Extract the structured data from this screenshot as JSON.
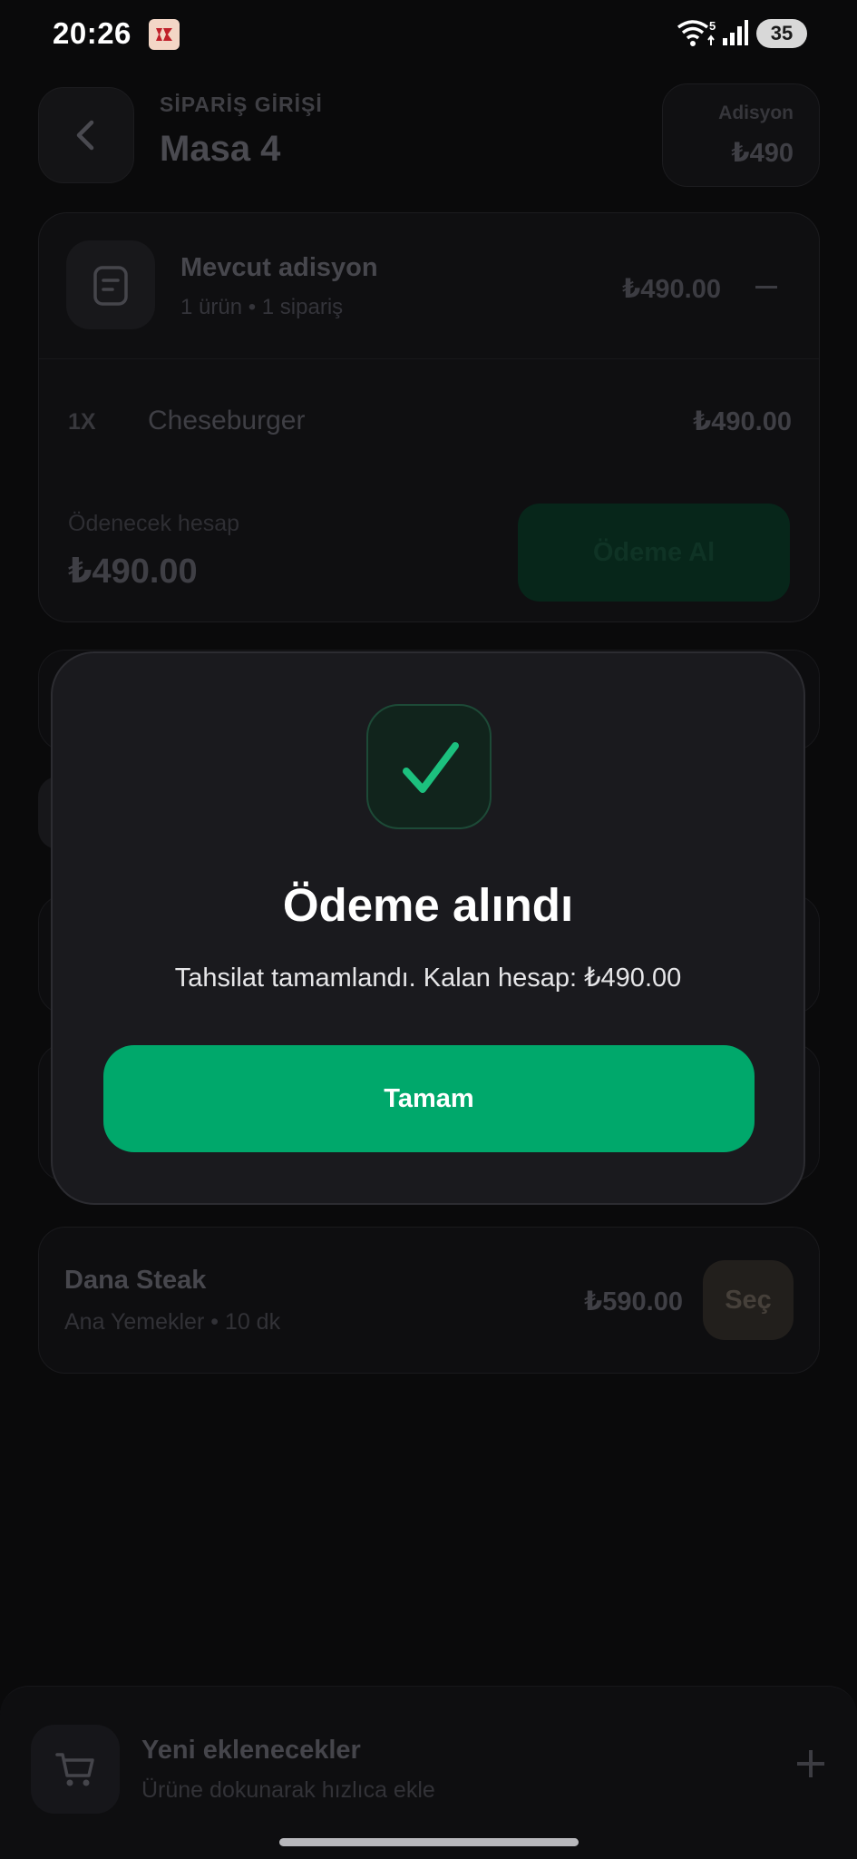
{
  "status_bar": {
    "time": "20:26",
    "battery": "35",
    "app_icon": "app-icon",
    "network_badge": "5"
  },
  "header": {
    "subtitle": "SİPARİŞ GİRİŞİ",
    "title": "Masa 4",
    "adisyon_label": "Adisyon",
    "adisyon_value": "₺490"
  },
  "order_card": {
    "title": "Mevcut adisyon",
    "subtitle": "1 ürün • 1 sipariş",
    "total": "₺490.00",
    "items": [
      {
        "qty": "1X",
        "name": "Cheseburger",
        "price": "₺490.00"
      }
    ],
    "payable_label": "Ödenecek hesap",
    "payable_total": "₺490.00",
    "pay_button": "Ödeme Al"
  },
  "menu_items": [
    {
      "name": "Dana Steak",
      "meta": "Ana Yemekler • 10 dk",
      "price": "₺590.00",
      "select_label": "Seç"
    }
  ],
  "bottom_bar": {
    "title": "Yeni eklenecekler",
    "subtitle": "Ürüne dokunarak hızlıca ekle"
  },
  "modal": {
    "title": "Ödeme alındı",
    "message": "Tahsilat tamamlandı. Kalan hesap: ₺490.00",
    "button": "Tamam",
    "icon": "check-icon"
  },
  "colors": {
    "accent": "#00a86b",
    "background": "#0a0a0b",
    "modal_bg": "#1a1a1e"
  }
}
